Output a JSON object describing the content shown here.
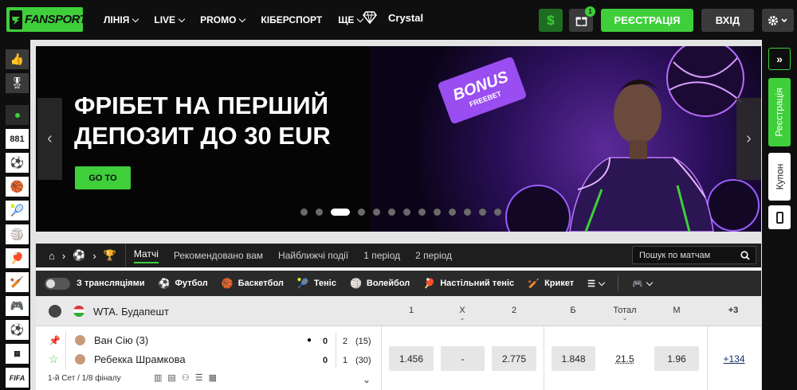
{
  "header": {
    "logo_text": "FANSPORT",
    "nav": [
      "ЛІНІЯ",
      "LIVE",
      "PROMO",
      "КІБЕРСПОРТ",
      "ЩЕ"
    ],
    "crystal": "Crystal",
    "dollar_symbol": "$",
    "gift_count": "1",
    "register_label": "РЕЄСТРАЦІЯ",
    "login_label": "ВХІД"
  },
  "leftbar": {
    "live_count": "881",
    "icons": [
      "thumbs-up-icon",
      "ribbon-icon",
      "live-dot-icon",
      "soccer-icon",
      "basketball-icon",
      "tennis-icon",
      "volleyball-icon",
      "table-tennis-icon",
      "cricket-icon",
      "gamepad-icon",
      "soccer-icon",
      "league-icon",
      "fifa-icon"
    ],
    "fifa_label": "FIFA"
  },
  "rightbar": {
    "expand": "»",
    "register": "Реєстрація",
    "coupon": "Купон"
  },
  "banner": {
    "title": "ФРІБЕТ НА ПЕРШИЙ ДЕПОЗИТ ДО 30 EUR",
    "button": "GO TO",
    "ticket_big": "BONUS",
    "ticket_small": "FREEBET",
    "slides": 13,
    "active_slide": 3,
    "prev": "‹",
    "next": "›"
  },
  "events": {
    "tabs": [
      "Матчі",
      "Рекомендовано вам",
      "Найближчі події",
      "1 період",
      "2 період"
    ],
    "search_placeholder": "Пошук по матчам",
    "streams_label": "З трансляціями",
    "sports": [
      "Футбол",
      "Баскетбол",
      "Теніс",
      "Волейбол",
      "Настільний теніс",
      "Крикет"
    ],
    "league": "WTA. Будапешт",
    "columns": [
      "1",
      "X",
      "2",
      "Б",
      "Тотал",
      "М",
      "+3"
    ],
    "match": {
      "player1": "Ван Сію (3)",
      "player2": "Ребекка Шрамкова",
      "p1_game": "0",
      "p2_game": "0",
      "p1_sets": "2",
      "p2_sets": "1",
      "p1_points": "(15)",
      "p2_points": "(30)",
      "odd1": "1.456",
      "oddx": "-",
      "odd2": "2.775",
      "over": "1.848",
      "total": "21.5",
      "under": "1.96",
      "more": "+134",
      "stage": "1-й Сет / 1/8 фіналу"
    }
  }
}
